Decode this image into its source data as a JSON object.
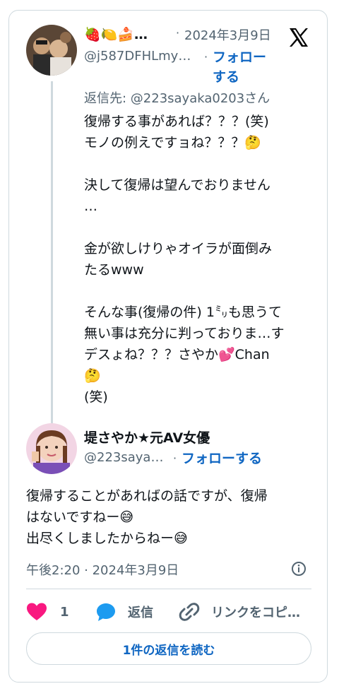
{
  "first_post": {
    "name": "🍓🍋🍰…",
    "handle": "@j587DFHLmy…",
    "dot": "·",
    "date": "2024年3月9日",
    "follow_line1": "フォロー",
    "follow_line2": "する",
    "reply_to": "返信先: @223sayaka0203さん",
    "text": "復帰する事があれば？？？(笑)\nモノの例えですョね？？？🤔\n\n決して復帰は望んでおりません\n…\n\n金が欲しけりゃオイラが面倒み\nたるwww\n\nそんな事(復帰の件) 1㍉も思うて\n無い事は充分に判っておりま…す\nデスょね？？？さやか💕Chan\n🤔\n(笑)"
  },
  "second_post": {
    "name": "堤さやか★元AV女優",
    "handle": "@223saya…",
    "dot": "·",
    "follow": "フォローする",
    "text": "復帰することがあればの話ですが、復帰\nはないですねー😅\n出尽くしましたからねー😅",
    "timestamp": "午後2:20 · 2024年3月9日"
  },
  "actions": {
    "like_count": "1",
    "reply_label": "返信",
    "copy_link_label": "リンクをコピ…"
  },
  "read_replies": "1件の返信を読む",
  "colors": {
    "accent": "#0f66c2",
    "like": "#f91880",
    "reply_icon": "#1d9bf0",
    "text": "#0f1419",
    "muted": "#536471"
  },
  "icons": [
    "x-logo-icon",
    "info-icon",
    "heart-icon",
    "reply-icon",
    "link-icon"
  ]
}
